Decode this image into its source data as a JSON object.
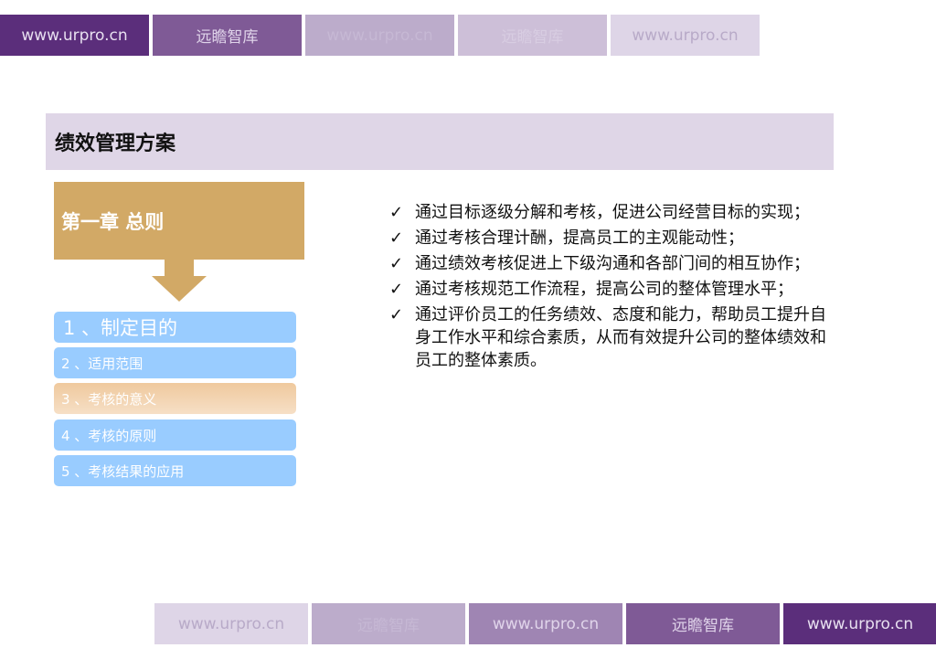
{
  "top_tabs": [
    {
      "label": "www.urpro.cn",
      "bg": "#5b2e7b",
      "fg": "#e8e0f0"
    },
    {
      "label": "远瞻智库",
      "bg": "#7f5a96",
      "fg": "#e0d4ea"
    },
    {
      "label": "www.urpro.cn",
      "bg": "#bcaccb",
      "fg": "#c6b8d4"
    },
    {
      "label": "远瞻智库",
      "bg": "#cdbfd8",
      "fg": "#d8cde2"
    },
    {
      "label": "www.urpro.cn",
      "bg": "#ded5e7",
      "fg": "#b8aac8"
    }
  ],
  "bottom_tabs": [
    {
      "label": "www.urpro.cn",
      "bg": "#ded5e7",
      "fg": "#b8aac8"
    },
    {
      "label": "远瞻智库",
      "bg": "#bcaccb",
      "fg": "#c6b8d4"
    },
    {
      "label": "www.urpro.cn",
      "bg": "#9f85b3",
      "fg": "#e0d4ea"
    },
    {
      "label": "远瞻智库",
      "bg": "#7f5a96",
      "fg": "#e0d4ea"
    },
    {
      "label": "www.urpro.cn",
      "bg": "#5b2e7b",
      "fg": "#e8e0f0"
    }
  ],
  "title": "绩效管理方案",
  "chapter": "第一章 总则",
  "items": [
    "1 、制定目的",
    "2 、适用范围",
    "3 、考核的意义",
    "4 、考核的原则",
    "5 、考核结果的应用"
  ],
  "bullets": [
    "通过目标逐级分解和考核，促进公司经营目标的实现；",
    "通过考核合理计酬，提高员工的主观能动性；",
    "通过绩效考核促进上下级沟通和各部门间的相互协作；",
    "通过考核规范工作流程，提高公司的整体管理水平；",
    "通过评价员工的任务绩效、态度和能力，帮助员工提升自身工作水平和综合素质，从而有效提升公司的整体绩效和员工的整体素质。"
  ],
  "check": "✓"
}
